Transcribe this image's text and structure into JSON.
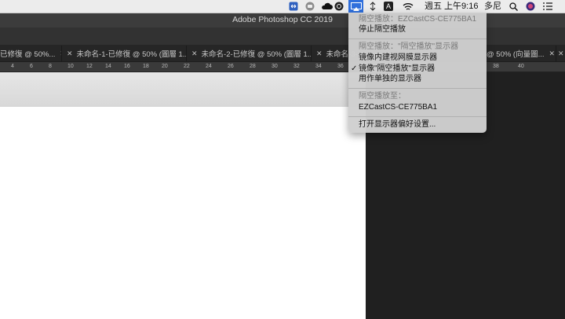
{
  "menubar": {
    "clock": "週五 上午9:16",
    "user": "多尼",
    "icons": [
      "teamviewer-icon",
      "camera-icon",
      "cloud-icon",
      "creative-cloud-icon",
      "ghost-icon",
      "airplay-icon",
      "transfer-icon",
      "input-method-icon",
      "wifi-icon",
      "search-icon",
      "siri-icon",
      "notification-list-icon"
    ],
    "input_method_letter": "A"
  },
  "app": {
    "title": "Adobe Photoshop CC 2019"
  },
  "tabs": [
    {
      "label": "已修復 @ 50%..."
    },
    {
      "label": "未命名-1-已修復 @ 50% (圖層 1..."
    },
    {
      "label": "未命名-2-已修復 @ 50% (圖層 1..."
    },
    {
      "label": "未命名-3-"
    },
    {
      "label": "@ 50% (向量圖..."
    }
  ],
  "ruler_ticks": [
    "4",
    "6",
    "8",
    "10",
    "12",
    "14",
    "16",
    "18",
    "20",
    "22",
    "24",
    "26",
    "28",
    "30",
    "32",
    "34",
    "36",
    "38",
    "40"
  ],
  "airplay_menu": {
    "header": "隔空播放：EZCastCS-CE775BA1",
    "stop": "停止隔空播放",
    "display_header": "隔空播放：\"隔空播放\"显示器",
    "mirror_builtin": "镜像内建视网膜显示器",
    "mirror_airplay": "镜像\"隔空播放\"显示器",
    "separate": "用作单独的显示器",
    "to_header": "隔空播放至：",
    "device": "EZCastCS-CE775BA1",
    "prefs": "打开显示器偏好设置..."
  },
  "colors": {
    "menubar_bg": "#ececec",
    "menu_bg": "#d0d0d0",
    "highlight": "#2f6fdc",
    "canvas": "#ffffff",
    "workspace": "#202020"
  }
}
